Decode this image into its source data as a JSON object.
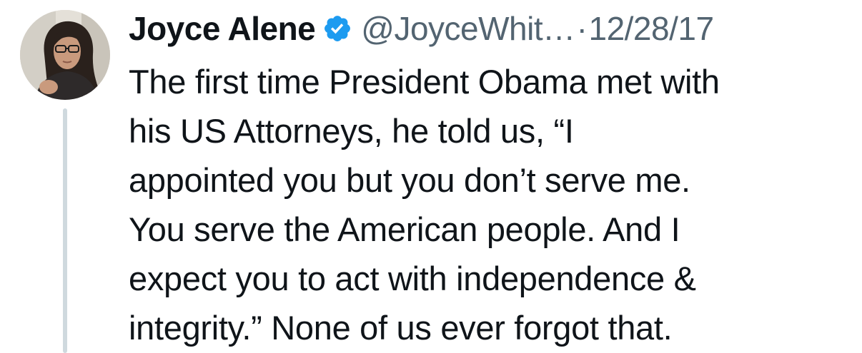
{
  "tweet": {
    "author": {
      "display_name": "Joyce Alene",
      "verified": true,
      "handle": "@JoyceWhit…",
      "avatar_icon": "profile-photo"
    },
    "separator": "·",
    "date": "12/28/17",
    "text_lines": [
      "The first time President Obama met with",
      "his US Attorneys, he told us, “I",
      "appointed you but you don’t serve me.",
      "You serve the American people. And I",
      "expect you to act with independence &",
      "integrity.” None of us ever forgot that."
    ]
  },
  "colors": {
    "text_primary": "#0f1419",
    "text_secondary": "#536471",
    "verified_blue": "#1d9bf0",
    "thread_line": "#cfd9de",
    "background": "#ffffff"
  }
}
